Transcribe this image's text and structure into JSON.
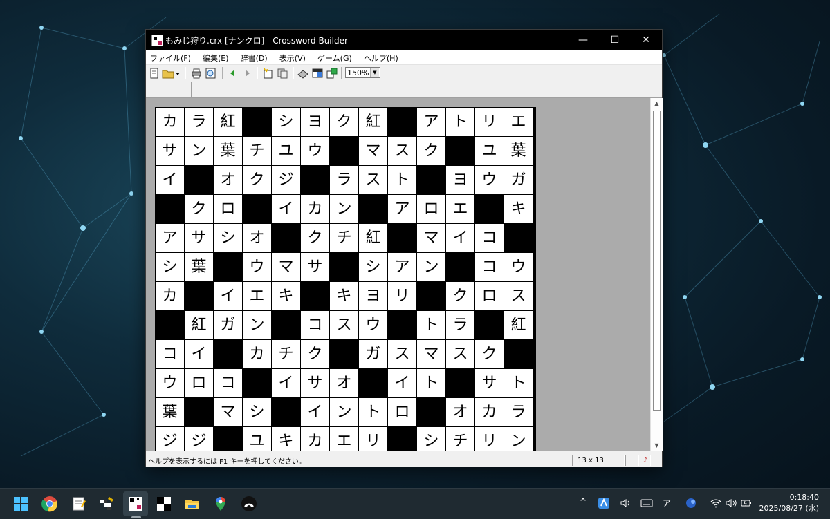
{
  "window": {
    "title": "もみじ狩り.crx [ナンクロ] - Crossword Builder",
    "controls": {
      "minimize": "—",
      "maximize": "☐",
      "close": "✕"
    }
  },
  "menu": [
    {
      "label": "ファイル(F)"
    },
    {
      "label": "編集(E)"
    },
    {
      "label": "辞書(D)"
    },
    {
      "label": "表示(V)"
    },
    {
      "label": "ゲーム(G)"
    },
    {
      "label": "ヘルプ(H)"
    }
  ],
  "toolbar": {
    "zoom_value": "150%",
    "icons": [
      "new-icon",
      "open-icon",
      "dropdown-icon",
      "print-icon",
      "print-preview-icon",
      "back-icon",
      "forward-icon",
      "add-word-icon",
      "dictionary-icon",
      "eraser-icon",
      "grid-icon",
      "export-icon"
    ]
  },
  "puzzle": {
    "rows": [
      [
        "カ",
        "ラ",
        "紅",
        "#",
        "シ",
        "ヨ",
        "ク",
        "紅",
        "#",
        "ア",
        "ト",
        "リ",
        "エ"
      ],
      [
        "サ",
        "ン",
        "葉",
        "チ",
        "ユ",
        "ウ",
        "#",
        "マ",
        "ス",
        "ク",
        "#",
        "ユ",
        "葉"
      ],
      [
        "イ",
        "#",
        "オ",
        "ク",
        "ジ",
        "#",
        "ラ",
        "ス",
        "ト",
        "#",
        "ヨ",
        "ウ",
        "ガ"
      ],
      [
        "#",
        "ク",
        "ロ",
        "#",
        "イ",
        "カ",
        "ン",
        "#",
        "ア",
        "ロ",
        "エ",
        "#",
        "キ"
      ],
      [
        "ア",
        "サ",
        "シ",
        "オ",
        "#",
        "ク",
        "チ",
        "紅",
        "#",
        "マ",
        "イ",
        "コ",
        "#"
      ],
      [
        "シ",
        "葉",
        "#",
        "ウ",
        "マ",
        "サ",
        "#",
        "シ",
        "ア",
        "ン",
        "#",
        "コ",
        "ウ"
      ],
      [
        "カ",
        "#",
        "イ",
        "エ",
        "キ",
        "#",
        "キ",
        "ヨ",
        "リ",
        "#",
        "ク",
        "ロ",
        "ス"
      ],
      [
        "#",
        "紅",
        "ガ",
        "ン",
        "#",
        "コ",
        "ス",
        "ウ",
        "#",
        "ト",
        "ラ",
        "#",
        "紅"
      ],
      [
        "コ",
        "イ",
        "#",
        "カ",
        "チ",
        "ク",
        "#",
        "ガ",
        "ス",
        "マ",
        "ス",
        "ク",
        "#"
      ],
      [
        "ウ",
        "ロ",
        "コ",
        "#",
        "イ",
        "サ",
        "オ",
        "#",
        "イ",
        "ト",
        "#",
        "サ",
        "ト"
      ],
      [
        "葉",
        "#",
        "マ",
        "シ",
        "#",
        "イ",
        "ン",
        "ト",
        "ロ",
        "#",
        "オ",
        "カ",
        "ラ"
      ],
      [
        "ジ",
        "ジ",
        "#",
        "ユ",
        "キ",
        "カ",
        "エ",
        "リ",
        "#",
        "シ",
        "チ",
        "リ",
        "ン"
      ]
    ]
  },
  "status": {
    "help_text": "ヘルプを表示するには F1 キーを押してください。",
    "grid_size": "13 x 13",
    "sound_icon": "♪"
  },
  "taskbar": {
    "apps": [
      "start-icon",
      "chrome-icon",
      "notepad-icon",
      "crossword-app-icon",
      "crossword-builder-icon",
      "puzzle-icon",
      "file-explorer-icon",
      "maps-icon",
      "streaming-icon"
    ],
    "tray": {
      "ime": "ア",
      "chevron": "^"
    },
    "clock_time": "0:18:40",
    "clock_date": "2025/08/27 (水)"
  },
  "colors": {
    "title_bar": "#000000",
    "grid_black": "#000000",
    "content_bg": "#ababab",
    "taskbar": "#1f2a31"
  }
}
